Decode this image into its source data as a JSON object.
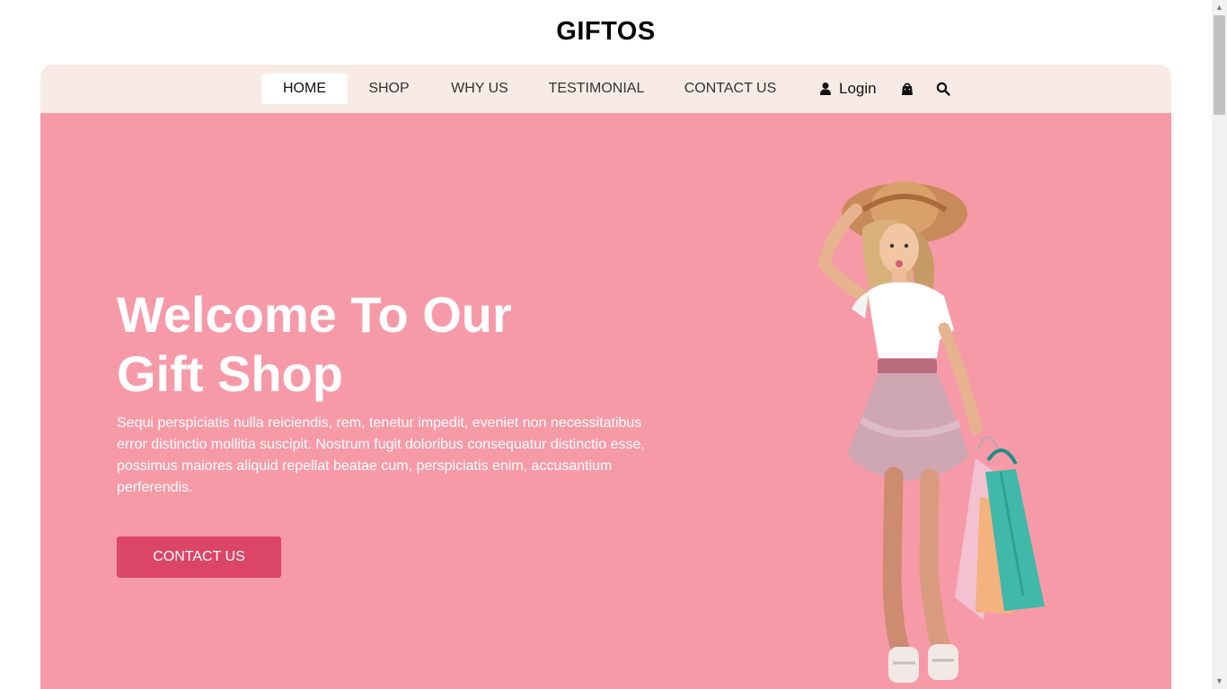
{
  "brand": {
    "name": "GIFTOS"
  },
  "nav": {
    "items": [
      {
        "label": "HOME",
        "active": true
      },
      {
        "label": "SHOP"
      },
      {
        "label": "WHY US"
      },
      {
        "label": "TESTIMONIAL"
      },
      {
        "label": "CONTACT US"
      }
    ],
    "login_label": "Login",
    "icons": {
      "user": "user-icon",
      "cart": "shopping-bag-icon",
      "search": "search-icon"
    }
  },
  "hero": {
    "title_line1": "Welcome To Our",
    "title_line2": "Gift Shop",
    "description": "Sequi perspiciatis nulla reiciendis, rem, tenetur impedit, eveniet non necessitatibus error distinctio mollitia suscipit. Nostrum fugit doloribus consequatur distinctio esse, possimus maiores aliquid repellat beatae cum, perspiciatis enim, accusantium perferendis.",
    "cta_label": "CONTACT US",
    "image": "girl-with-shopping-bags-image"
  },
  "colors": {
    "nav_background": "#f8ebe5",
    "hero_background": "#f79aa8",
    "accent": "#db4566",
    "text_light": "#ffffff",
    "text_dark": "#111111"
  },
  "scrollbar": {
    "up_arrow": "▲",
    "down_arrow": "▼"
  }
}
